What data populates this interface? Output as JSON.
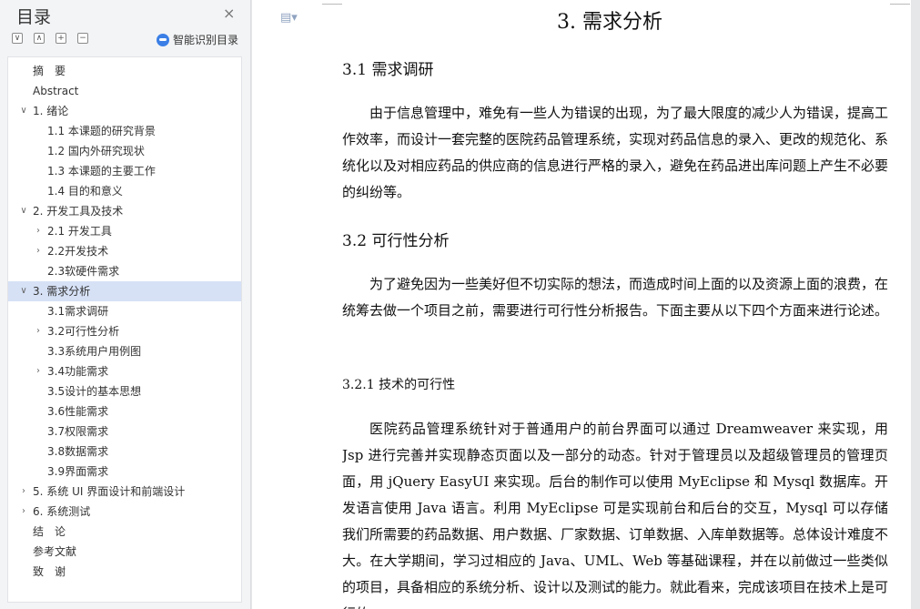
{
  "nav": {
    "title": "目录",
    "close_glyph": "×",
    "tool_buttons": [
      "∨",
      "∧",
      "+",
      "−"
    ],
    "ai_label": "智能识别目录",
    "items": [
      {
        "label": "摘　要",
        "level": 0,
        "arrow": "",
        "selected": false
      },
      {
        "label": "Abstract",
        "level": 0,
        "arrow": "",
        "selected": false
      },
      {
        "label": "1.  绪论",
        "level": 0,
        "arrow": "∨",
        "selected": false
      },
      {
        "label": "1.1  本课题的研究背景",
        "level": 1,
        "arrow": "",
        "selected": false
      },
      {
        "label": "1.2  国内外研究现状",
        "level": 1,
        "arrow": "",
        "selected": false
      },
      {
        "label": "1.3  本课题的主要工作",
        "level": 1,
        "arrow": "",
        "selected": false
      },
      {
        "label": "1.4  目的和意义",
        "level": 1,
        "arrow": "",
        "selected": false
      },
      {
        "label": "2.  开发工具及技术",
        "level": 0,
        "arrow": "∨",
        "selected": false
      },
      {
        "label": "2.1  开发工具",
        "level": 1,
        "arrow": "›",
        "selected": false
      },
      {
        "label": "2.2开发技术",
        "level": 1,
        "arrow": "›",
        "selected": false
      },
      {
        "label": "2.3软硬件需求",
        "level": 1,
        "arrow": "",
        "selected": false
      },
      {
        "label": "3.  需求分析",
        "level": 0,
        "arrow": "∨",
        "selected": true
      },
      {
        "label": "3.1需求调研",
        "level": 1,
        "arrow": "",
        "selected": false
      },
      {
        "label": "3.2可行性分析",
        "level": 1,
        "arrow": "›",
        "selected": false
      },
      {
        "label": "3.3系统用户用例图",
        "level": 1,
        "arrow": "",
        "selected": false
      },
      {
        "label": "3.4功能需求",
        "level": 1,
        "arrow": "›",
        "selected": false
      },
      {
        "label": "3.5设计的基本思想",
        "level": 1,
        "arrow": "",
        "selected": false
      },
      {
        "label": "3.6性能需求",
        "level": 1,
        "arrow": "",
        "selected": false
      },
      {
        "label": "3.7权限需求",
        "level": 1,
        "arrow": "",
        "selected": false
      },
      {
        "label": "3.8数据需求",
        "level": 1,
        "arrow": "",
        "selected": false
      },
      {
        "label": "3.9界面需求",
        "level": 1,
        "arrow": "",
        "selected": false
      },
      {
        "label": "5.  系统 UI 界面设计和前端设计",
        "level": 0,
        "arrow": "›",
        "selected": false
      },
      {
        "label": "6.  系统测试",
        "level": 0,
        "arrow": "›",
        "selected": false
      },
      {
        "label": "结　论",
        "level": 0,
        "arrow": "",
        "selected": false
      },
      {
        "label": "参考文献",
        "level": 0,
        "arrow": "",
        "selected": false
      },
      {
        "label": "致　谢",
        "level": 0,
        "arrow": "",
        "selected": false
      }
    ]
  },
  "doc": {
    "heading1": "3. 需求分析",
    "heading_3_1": "3.1 需求调研",
    "para1": "由于信息管理中，难免有一些人为错误的出现，为了最大限度的减少人为错误，提高工作效率，而设计一套完整的医院药品管理系统，实现对药品信息的录入、更改的规范化、系统化以及对相应药品的供应商的信息进行严格的录入，避免在药品进出库问题上产生不必要的纠纷等。",
    "heading_3_2": "3.2 可行性分析",
    "para2": "为了避免因为一些美好但不切实际的想法，而造成时间上面的以及资源上面的浪费，在统筹去做一个项目之前，需要进行可行性分析报告。下面主要从以下四个方面来进行论述。",
    "heading_3_2_1": "3.2.1 技术的可行性",
    "para3": "医院药品管理系统针对于普通用户的前台界面可以通过 Dreamweaver 来实现，用 Jsp 进行完善并实现静态页面以及一部分的动态。针对于管理员以及超级管理员的管理页面，用 jQuery EasyUI 来实现。后台的制作可以使用 MyEclipse 和 Mysql 数据库。开发语言使用 Java 语言。利用 MyEclipse 可是实现前台和后台的交互，Mysql 可以存储我们所需要的药品数据、用户数据、厂家数据、订单数据、入库单数据等。总体设计难度不大。在大学期间，学习过相应的 Java、UML、Web 等基础课程，并在以前做过一些类似的项目，具备相应的系统分析、设计以及测试的能力。就此看来，完成该项目在技术上是可行的。"
  },
  "icons": {
    "page": "document-dropdown-icon",
    "ai": "ai-assistant-icon",
    "close": "close-icon"
  },
  "colors": {
    "selected_bg": "#d6e1f6",
    "ai_icon": "#3b7fe6"
  }
}
